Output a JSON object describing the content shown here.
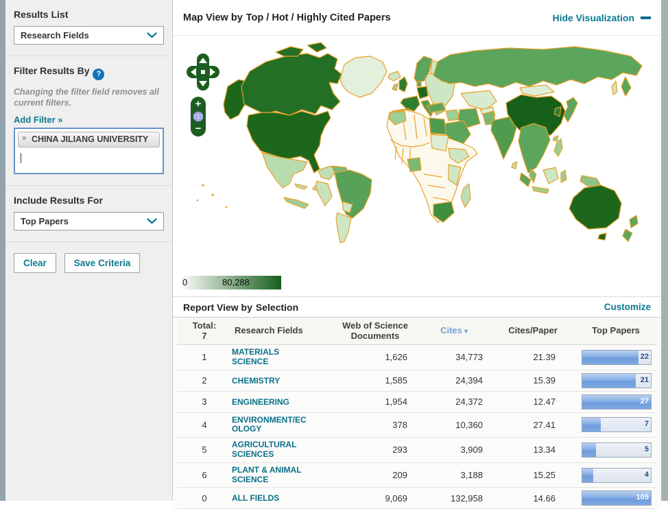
{
  "sidebar": {
    "results_list": {
      "label": "Results List",
      "selected": "Research Fields"
    },
    "filter": {
      "title": "Filter Results By",
      "help_icon": "?",
      "note": "Changing the filter field removes all current filters.",
      "add_filter": "Add Filter »",
      "tag": {
        "remove_icon": "×",
        "label": "CHINA JILIANG UNIVERSITY"
      }
    },
    "include_results": {
      "label": "Include Results For",
      "selected": "Top Papers"
    },
    "actions": {
      "clear": "Clear",
      "save": "Save Criteria"
    }
  },
  "map_panel": {
    "title_prefix": "Map View by",
    "title_value": "Top / Hot / Highly Cited Papers",
    "hide_link": "Hide Visualization",
    "controls": {
      "zoom_in": "+",
      "zoom_out": "−"
    },
    "legend": {
      "min": "0",
      "max": "80,288"
    },
    "palette": {
      "none": "#fcf9ec",
      "very_low": "#ddeed6",
      "low": "#bedfb6",
      "mid_low": "#9ccf93",
      "mid": "#5ba55c",
      "mid_high": "#2f7d31",
      "high": "#1d671d",
      "highest": "#16601a",
      "border": "#e9a129"
    }
  },
  "report_panel": {
    "title_prefix": "Report View by",
    "title_value": "Selection",
    "customize_link": "Customize",
    "table": {
      "total_label": "Total:",
      "total_value": "7",
      "columns": {
        "field": "Research Fields",
        "docs": "Web of Science Documents",
        "cites": "Cites",
        "sort_icon": "▾",
        "cpp": "Cites/Paper",
        "top": "Top Papers"
      },
      "rows": [
        {
          "rank": "1",
          "field": "MATERIALS SCIENCE",
          "docs": "1,626",
          "cites": "34,773",
          "cpp": "21.39",
          "top": "22",
          "bar_pct": 82
        },
        {
          "rank": "2",
          "field": "CHEMISTRY",
          "docs": "1,585",
          "cites": "24,394",
          "cpp": "15.39",
          "top": "21",
          "bar_pct": 78
        },
        {
          "rank": "3",
          "field": "ENGINEERING",
          "docs": "1,954",
          "cites": "24,372",
          "cpp": "12.47",
          "top": "27",
          "bar_pct": 100
        },
        {
          "rank": "4",
          "field": "ENVIRONMENT/ECOLOGY",
          "docs": "378",
          "cites": "10,360",
          "cpp": "27.41",
          "top": "7",
          "bar_pct": 27
        },
        {
          "rank": "5",
          "field": "AGRICULTURAL SCIENCES",
          "docs": "293",
          "cites": "3,909",
          "cpp": "13.34",
          "top": "5",
          "bar_pct": 20
        },
        {
          "rank": "6",
          "field": "PLANT & ANIMAL SCIENCE",
          "docs": "209",
          "cites": "3,188",
          "cpp": "15.25",
          "top": "4",
          "bar_pct": 16
        },
        {
          "rank": "0",
          "field": "ALL FIELDS",
          "docs": "9,069",
          "cites": "132,958",
          "cpp": "14.66",
          "top": "105",
          "bar_pct": 100
        }
      ]
    }
  }
}
